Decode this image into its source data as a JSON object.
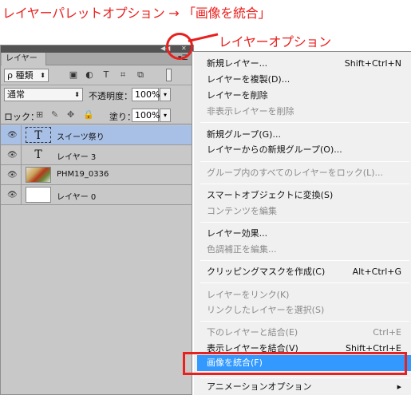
{
  "caption": "レイヤーパレットオプション → 「画像を統合」",
  "annotation": "レイヤーオプション",
  "colors": {
    "annotation_red": "#e8201e",
    "highlight": "#3399ff",
    "selected_layer": "#a9c0e6"
  },
  "panel": {
    "tab_label": "レイヤー",
    "filter_select": "ρ 種類",
    "blend_mode": "通常",
    "opacity_label": "不透明度：",
    "opacity_value": "100%",
    "lock_label": "ロック：",
    "fill_label": "塗り：",
    "fill_value": "100%",
    "layers": [
      {
        "name": "スイーツ祭り",
        "thumb": "T",
        "selected": true
      },
      {
        "name": "レイヤー 3",
        "thumb": "T",
        "selected": false
      },
      {
        "name": "PHM19_0336",
        "thumb": "",
        "selected": false
      },
      {
        "name": "レイヤー 0",
        "thumb": "",
        "selected": false
      }
    ]
  },
  "menu": {
    "items": [
      {
        "label": "新規レイヤー...",
        "shortcut": "Shift+Ctrl+N"
      },
      {
        "label": "レイヤーを複製(D)...",
        "shortcut": ""
      },
      {
        "label": "レイヤーを削除",
        "shortcut": ""
      },
      {
        "label": "非表示レイヤーを削除",
        "shortcut": ""
      },
      {
        "label": "新規グループ(G)...",
        "shortcut": ""
      },
      {
        "label": "レイヤーからの新規グループ(O)...",
        "shortcut": ""
      },
      {
        "label": "グループ内のすべてのレイヤーをロック(L)...",
        "shortcut": ""
      },
      {
        "label": "スマートオブジェクトに変換(S)",
        "shortcut": ""
      },
      {
        "label": "コンテンツを編集",
        "shortcut": ""
      },
      {
        "label": "レイヤー効果...",
        "shortcut": ""
      },
      {
        "label": "色調補正を編集...",
        "shortcut": ""
      },
      {
        "label": "クリッピングマスクを作成(C)",
        "shortcut": "Alt+Ctrl+G"
      },
      {
        "label": "レイヤーをリンク(K)",
        "shortcut": ""
      },
      {
        "label": "リンクしたレイヤーを選択(S)",
        "shortcut": ""
      },
      {
        "label": "下のレイヤーと結合(E)",
        "shortcut": "Ctrl+E"
      },
      {
        "label": "表示レイヤーを結合(V)",
        "shortcut": "Shift+Ctrl+E"
      },
      {
        "label": "画像を統合(F)",
        "shortcut": ""
      },
      {
        "label": "アニメーションオプション",
        "shortcut": ""
      }
    ]
  }
}
